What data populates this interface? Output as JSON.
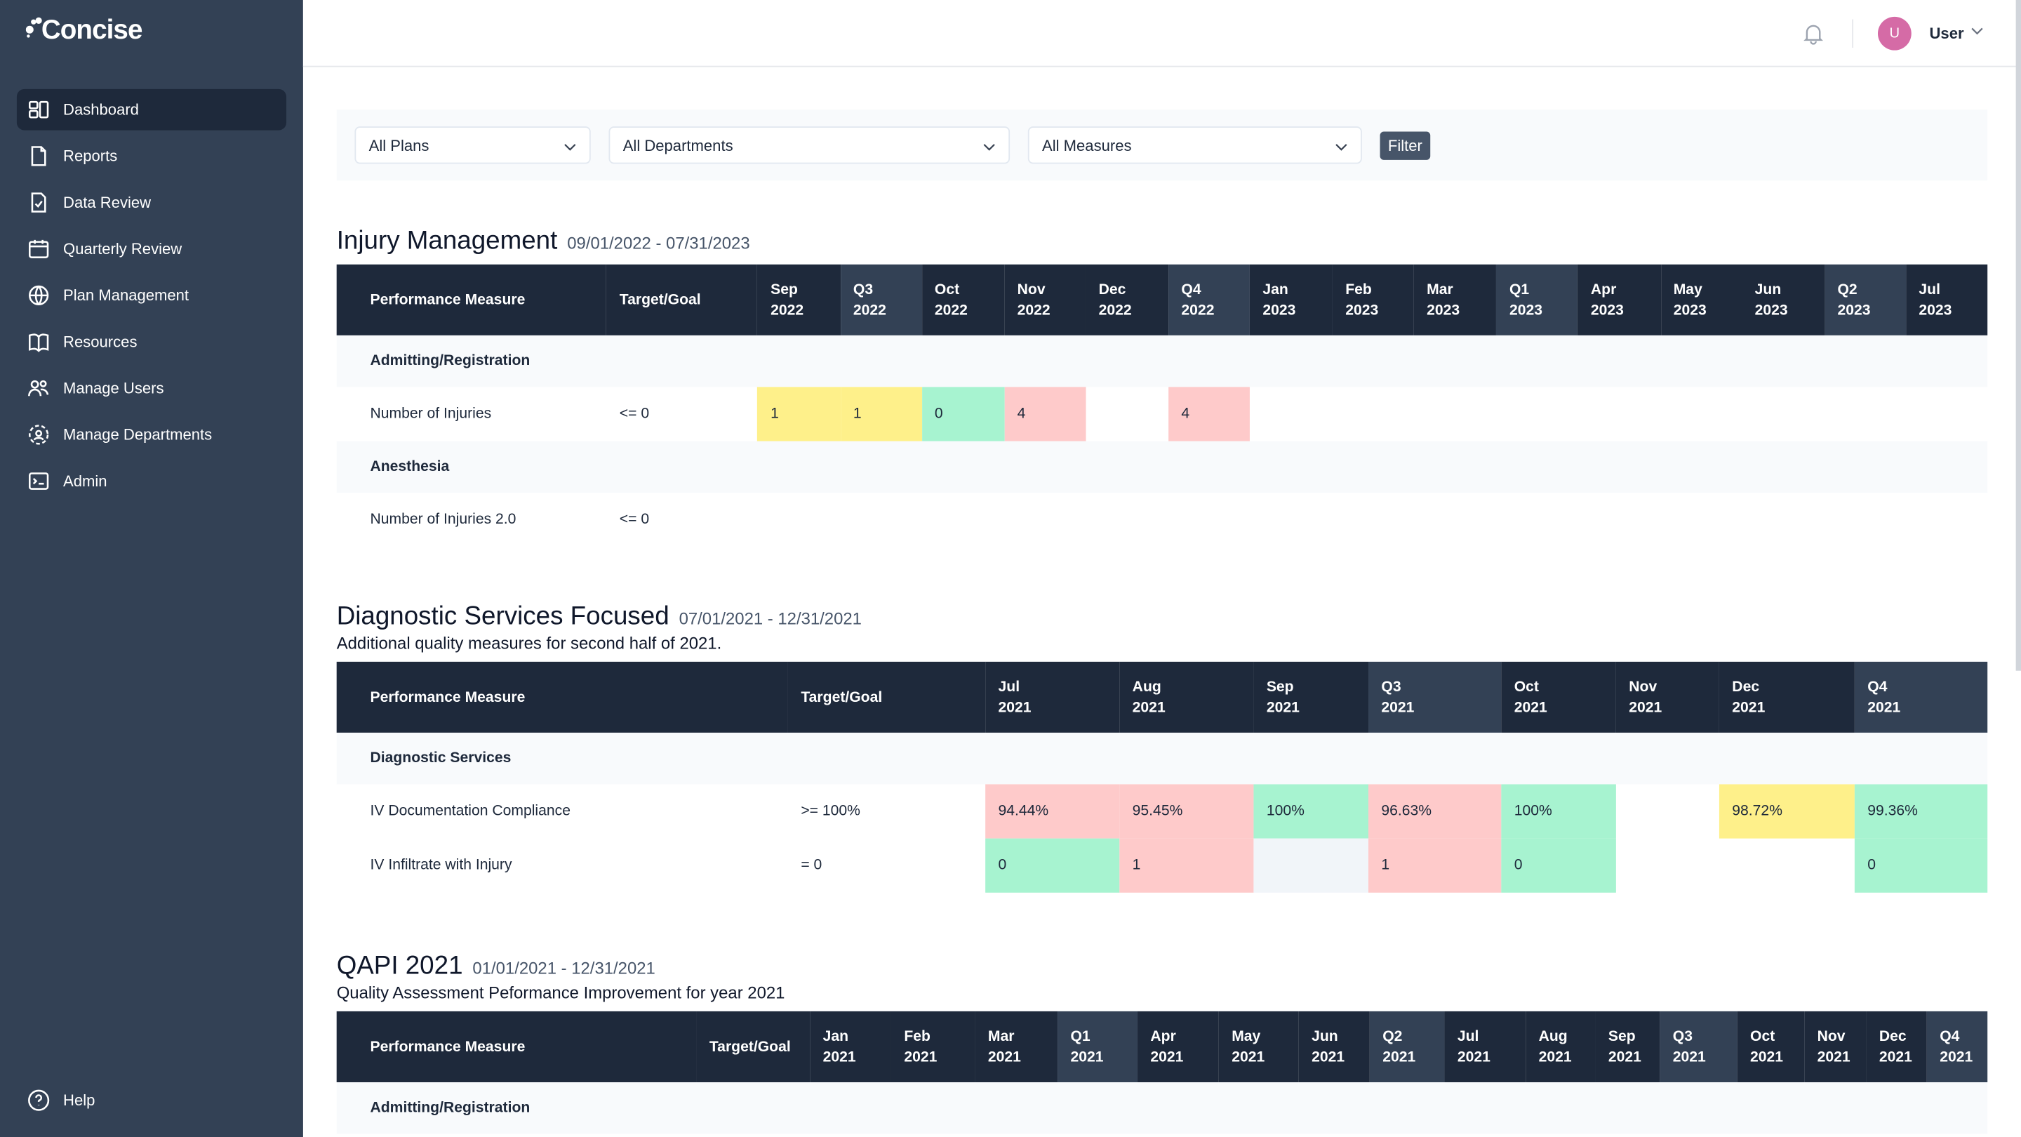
{
  "app": {
    "logo_text": "Concise"
  },
  "sidebar": {
    "items": [
      {
        "label": "Dashboard",
        "icon": "dashboard-icon",
        "active": true
      },
      {
        "label": "Reports",
        "icon": "file-icon"
      },
      {
        "label": "Data Review",
        "icon": "file-check-icon"
      },
      {
        "label": "Quarterly Review",
        "icon": "calendar-icon"
      },
      {
        "label": "Plan Management",
        "icon": "globe-icon"
      },
      {
        "label": "Resources",
        "icon": "book-icon"
      },
      {
        "label": "Manage Users",
        "icon": "users-icon"
      },
      {
        "label": "Manage Departments",
        "icon": "departments-icon"
      },
      {
        "label": "Admin",
        "icon": "terminal-icon"
      }
    ],
    "help": "Help"
  },
  "header": {
    "avatar_initial": "U",
    "user_name": "User",
    "avatar_color": "#d56ba6"
  },
  "filters": {
    "plans": "All Plans",
    "departments": "All Departments",
    "measures": "All Measures",
    "filter_button": "Filter"
  },
  "status_colors": {
    "red": "#fecaca",
    "green": "#a7f3d0",
    "yellow": "#fef08a",
    "na": "#f1f5f9"
  },
  "sections": [
    {
      "title": "Injury Management",
      "dates": "09/01/2022 - 07/31/2023",
      "subtitle": "",
      "columns": [
        "Performance Measure",
        "Target/Goal",
        "Sep 2022",
        "Q3 2022",
        "Oct 2022",
        "Nov 2022",
        "Dec 2022",
        "Q4 2022",
        "Jan 2023",
        "Feb 2023",
        "Mar 2023",
        "Q1 2023",
        "Apr 2023",
        "May 2023",
        "Jun 2023",
        "Q2 2023",
        "Jul 2023"
      ],
      "rows": [
        {
          "group": "Admitting/Registration"
        },
        {
          "measure": "Number of Injuries",
          "target": "<= 0",
          "cells": [
            {
              "v": "1",
              "s": "yellow"
            },
            {
              "v": "1",
              "s": "yellow"
            },
            {
              "v": "0",
              "s": "green"
            },
            {
              "v": "4",
              "s": "red"
            },
            {
              "v": ""
            },
            {
              "v": "4",
              "s": "red"
            },
            {
              "v": ""
            },
            {
              "v": ""
            },
            {
              "v": ""
            },
            {
              "v": ""
            },
            {
              "v": ""
            },
            {
              "v": ""
            },
            {
              "v": ""
            },
            {
              "v": ""
            },
            {
              "v": ""
            }
          ]
        },
        {
          "group": "Anesthesia"
        },
        {
          "measure": "Number of Injuries 2.0",
          "target": "<= 0",
          "cells": []
        }
      ]
    },
    {
      "title": "Diagnostic Services Focused",
      "dates": "07/01/2021 - 12/31/2021",
      "subtitle": "Additional quality measures for second half of 2021.",
      "columns": [
        "Performance Measure",
        "Target/Goal",
        "Jul 2021",
        "Aug 2021",
        "Sep 2021",
        "Q3 2021",
        "Oct 2021",
        "Nov 2021",
        "Dec 2021",
        "Q4 2021"
      ],
      "rows": [
        {
          "group": "Diagnostic Services"
        },
        {
          "measure": "IV Documentation Compliance",
          "target": ">= 100%",
          "cells": [
            {
              "v": "94.44%",
              "s": "red"
            },
            {
              "v": "95.45%",
              "s": "red"
            },
            {
              "v": "100%",
              "s": "green"
            },
            {
              "v": "96.63%",
              "s": "red"
            },
            {
              "v": "100%",
              "s": "green"
            },
            {
              "v": ""
            },
            {
              "v": "98.72%",
              "s": "yellow"
            },
            {
              "v": "99.36%",
              "s": "green"
            }
          ]
        },
        {
          "measure": "IV Infiltrate with Injury",
          "target": "= 0",
          "cells": [
            {
              "v": "0",
              "s": "green"
            },
            {
              "v": "1",
              "s": "red"
            },
            {
              "v": "",
              "s": "na"
            },
            {
              "v": "1",
              "s": "red"
            },
            {
              "v": "0",
              "s": "green"
            },
            {
              "v": ""
            },
            {
              "v": ""
            },
            {
              "v": "0",
              "s": "green"
            }
          ]
        }
      ]
    },
    {
      "title": "QAPI 2021",
      "dates": "01/01/2021 - 12/31/2021",
      "subtitle": "Quality Assessment Peformance Improvement for year 2021",
      "columns": [
        "Performance Measure",
        "Target/Goal",
        "Jan 2021",
        "Feb 2021",
        "Mar 2021",
        "Q1 2021",
        "Apr 2021",
        "May 2021",
        "Jun 2021",
        "Q2 2021",
        "Jul 2021",
        "Aug 2021",
        "Sep 2021",
        "Q3 2021",
        "Oct 2021",
        "Nov 2021",
        "Dec 2021",
        "Q4 2021"
      ],
      "rows": [
        {
          "group": "Admitting/Registration"
        }
      ]
    }
  ]
}
